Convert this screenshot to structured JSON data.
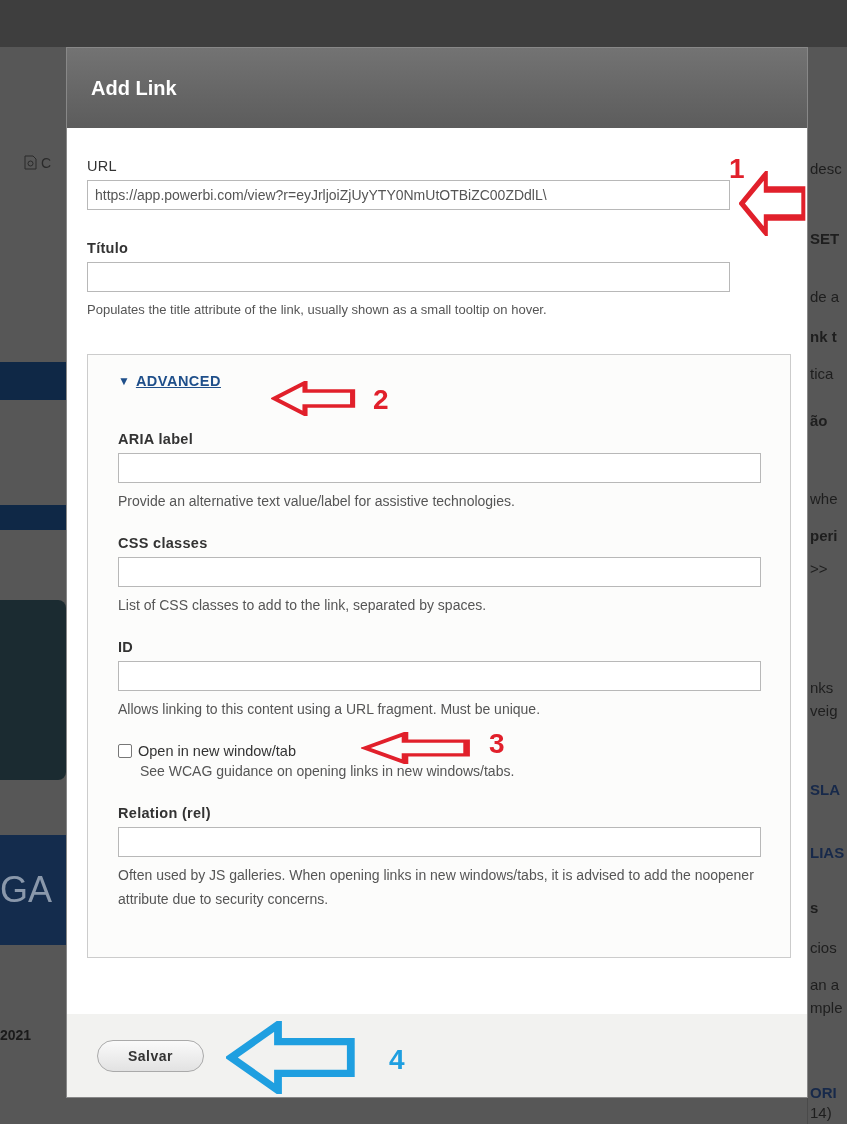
{
  "background": {
    "left": [
      {
        "kind": "text",
        "text": "C"
      },
      {
        "kind": "banner",
        "text": "GA"
      },
      {
        "kind": "heading",
        "text": "2021"
      }
    ],
    "right": [
      {
        "kind": "text",
        "text": "desc"
      },
      {
        "kind": "heading",
        "text": "SET"
      },
      {
        "kind": "text",
        "text": "de a"
      },
      {
        "kind": "heading",
        "text": "nk t"
      },
      {
        "kind": "text",
        "text": "tica"
      },
      {
        "kind": "heading",
        "text": "ão"
      },
      {
        "kind": "text",
        "text": "whe"
      },
      {
        "kind": "heading",
        "text": "peri"
      },
      {
        "kind": "text",
        "text": ">>"
      },
      {
        "kind": "text",
        "text": "nks"
      },
      {
        "kind": "text",
        "text": "veig"
      },
      {
        "kind": "link",
        "text": "SLA"
      },
      {
        "kind": "link",
        "text": "LIAS"
      },
      {
        "kind": "heading",
        "text": "s"
      },
      {
        "kind": "text",
        "text": "cios"
      },
      {
        "kind": "text",
        "text": "an a"
      },
      {
        "kind": "text",
        "text": "mple"
      },
      {
        "kind": "link",
        "text": "ORI"
      },
      {
        "kind": "text",
        "text": "14)"
      }
    ]
  },
  "dialog": {
    "title": "Add Link",
    "url": {
      "label": "URL",
      "value": "https://app.powerbi.com/view?r=eyJrljoiZjUyYTY0NmUtOTBiZC00ZDdlL\\"
    },
    "title_field": {
      "label": "Título",
      "description": "Populates the title attribute of the link, usually shown as a small tooltip on hover."
    },
    "advanced": {
      "toggle": "▼",
      "summary": "ADVANCED",
      "expanded": true,
      "fields": [
        {
          "kind": "text",
          "label": "ARIA label",
          "description": "Provide an alternative text value/label for assistive technologies."
        },
        {
          "kind": "text",
          "label": "CSS classes",
          "description": "List of CSS classes to add to the link, separated by spaces."
        },
        {
          "kind": "text",
          "label": "ID",
          "description": "Allows linking to this content using a URL fragment. Must be unique."
        },
        {
          "kind": "checkbox",
          "label": "Open in new window/tab",
          "checked": false,
          "description": "See WCAG guidance on opening links in new windows/tabs."
        },
        {
          "kind": "text",
          "label": "Relation (rel)",
          "description": "Often used by JS galleries. When opening links in new windows/tabs, it is advised to add the noopener attribute due to security concerns."
        }
      ]
    },
    "save_button": "Salvar"
  },
  "annotations": [
    {
      "number": "1",
      "color": "#e1202b"
    },
    {
      "number": "2",
      "color": "#e1202b"
    },
    {
      "number": "3",
      "color": "#e1202b"
    },
    {
      "number": "4",
      "color": "#1f9fe0"
    }
  ]
}
